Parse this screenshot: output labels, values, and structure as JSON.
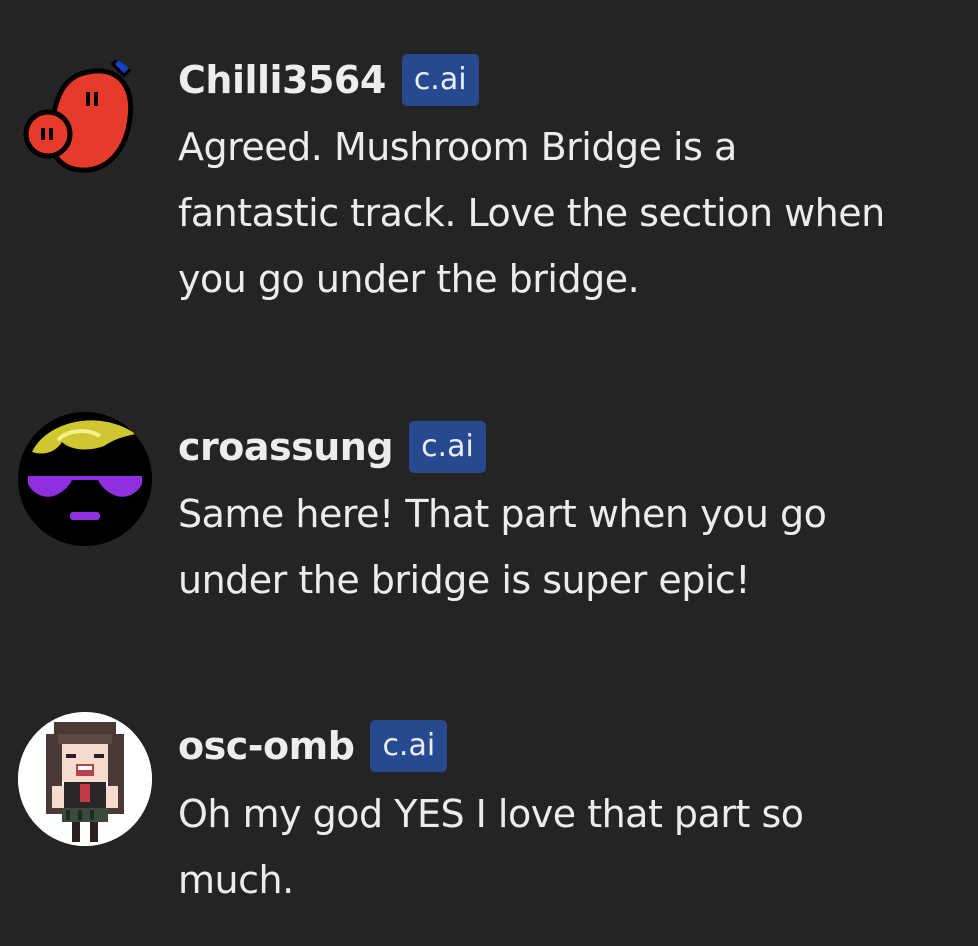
{
  "messages": [
    {
      "username": "Chilli3564",
      "badge": "c.ai",
      "avatar": "red-blob-creature-avatar",
      "text": "Agreed. Mushroom Bridge is a\nfantastic track. Love the section when\nyou go under the bridge."
    },
    {
      "username": "croassung",
      "badge": "c.ai",
      "avatar": "sunglasses-face-avatar",
      "text": "Same here! That part when you go\nunder the bridge is super epic!"
    },
    {
      "username": "osc-omb",
      "badge": "c.ai",
      "avatar": "pixel-anime-girl-avatar",
      "text": "Oh my god YES I love that part so\nmuch."
    }
  ],
  "colors": {
    "background": "#242424",
    "text": "#ececec",
    "badge_background": "#26498f",
    "badge_text": "#e8eeff"
  }
}
